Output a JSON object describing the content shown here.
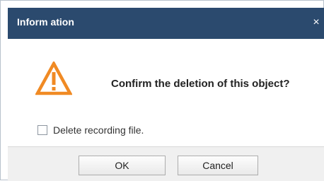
{
  "dialog": {
    "title": "Inform ation",
    "close_symbol": "×",
    "message": "Confirm the deletion of this object?",
    "icon": "warning-triangle-icon",
    "checkbox": {
      "label": "Delete recording file.",
      "checked": false
    },
    "buttons": {
      "ok_label": "OK",
      "cancel_label": "Cancel"
    }
  },
  "colors": {
    "titlebar": "#2b4a6e",
    "warning": "#f08a24",
    "footer": "#f0f0f0"
  }
}
